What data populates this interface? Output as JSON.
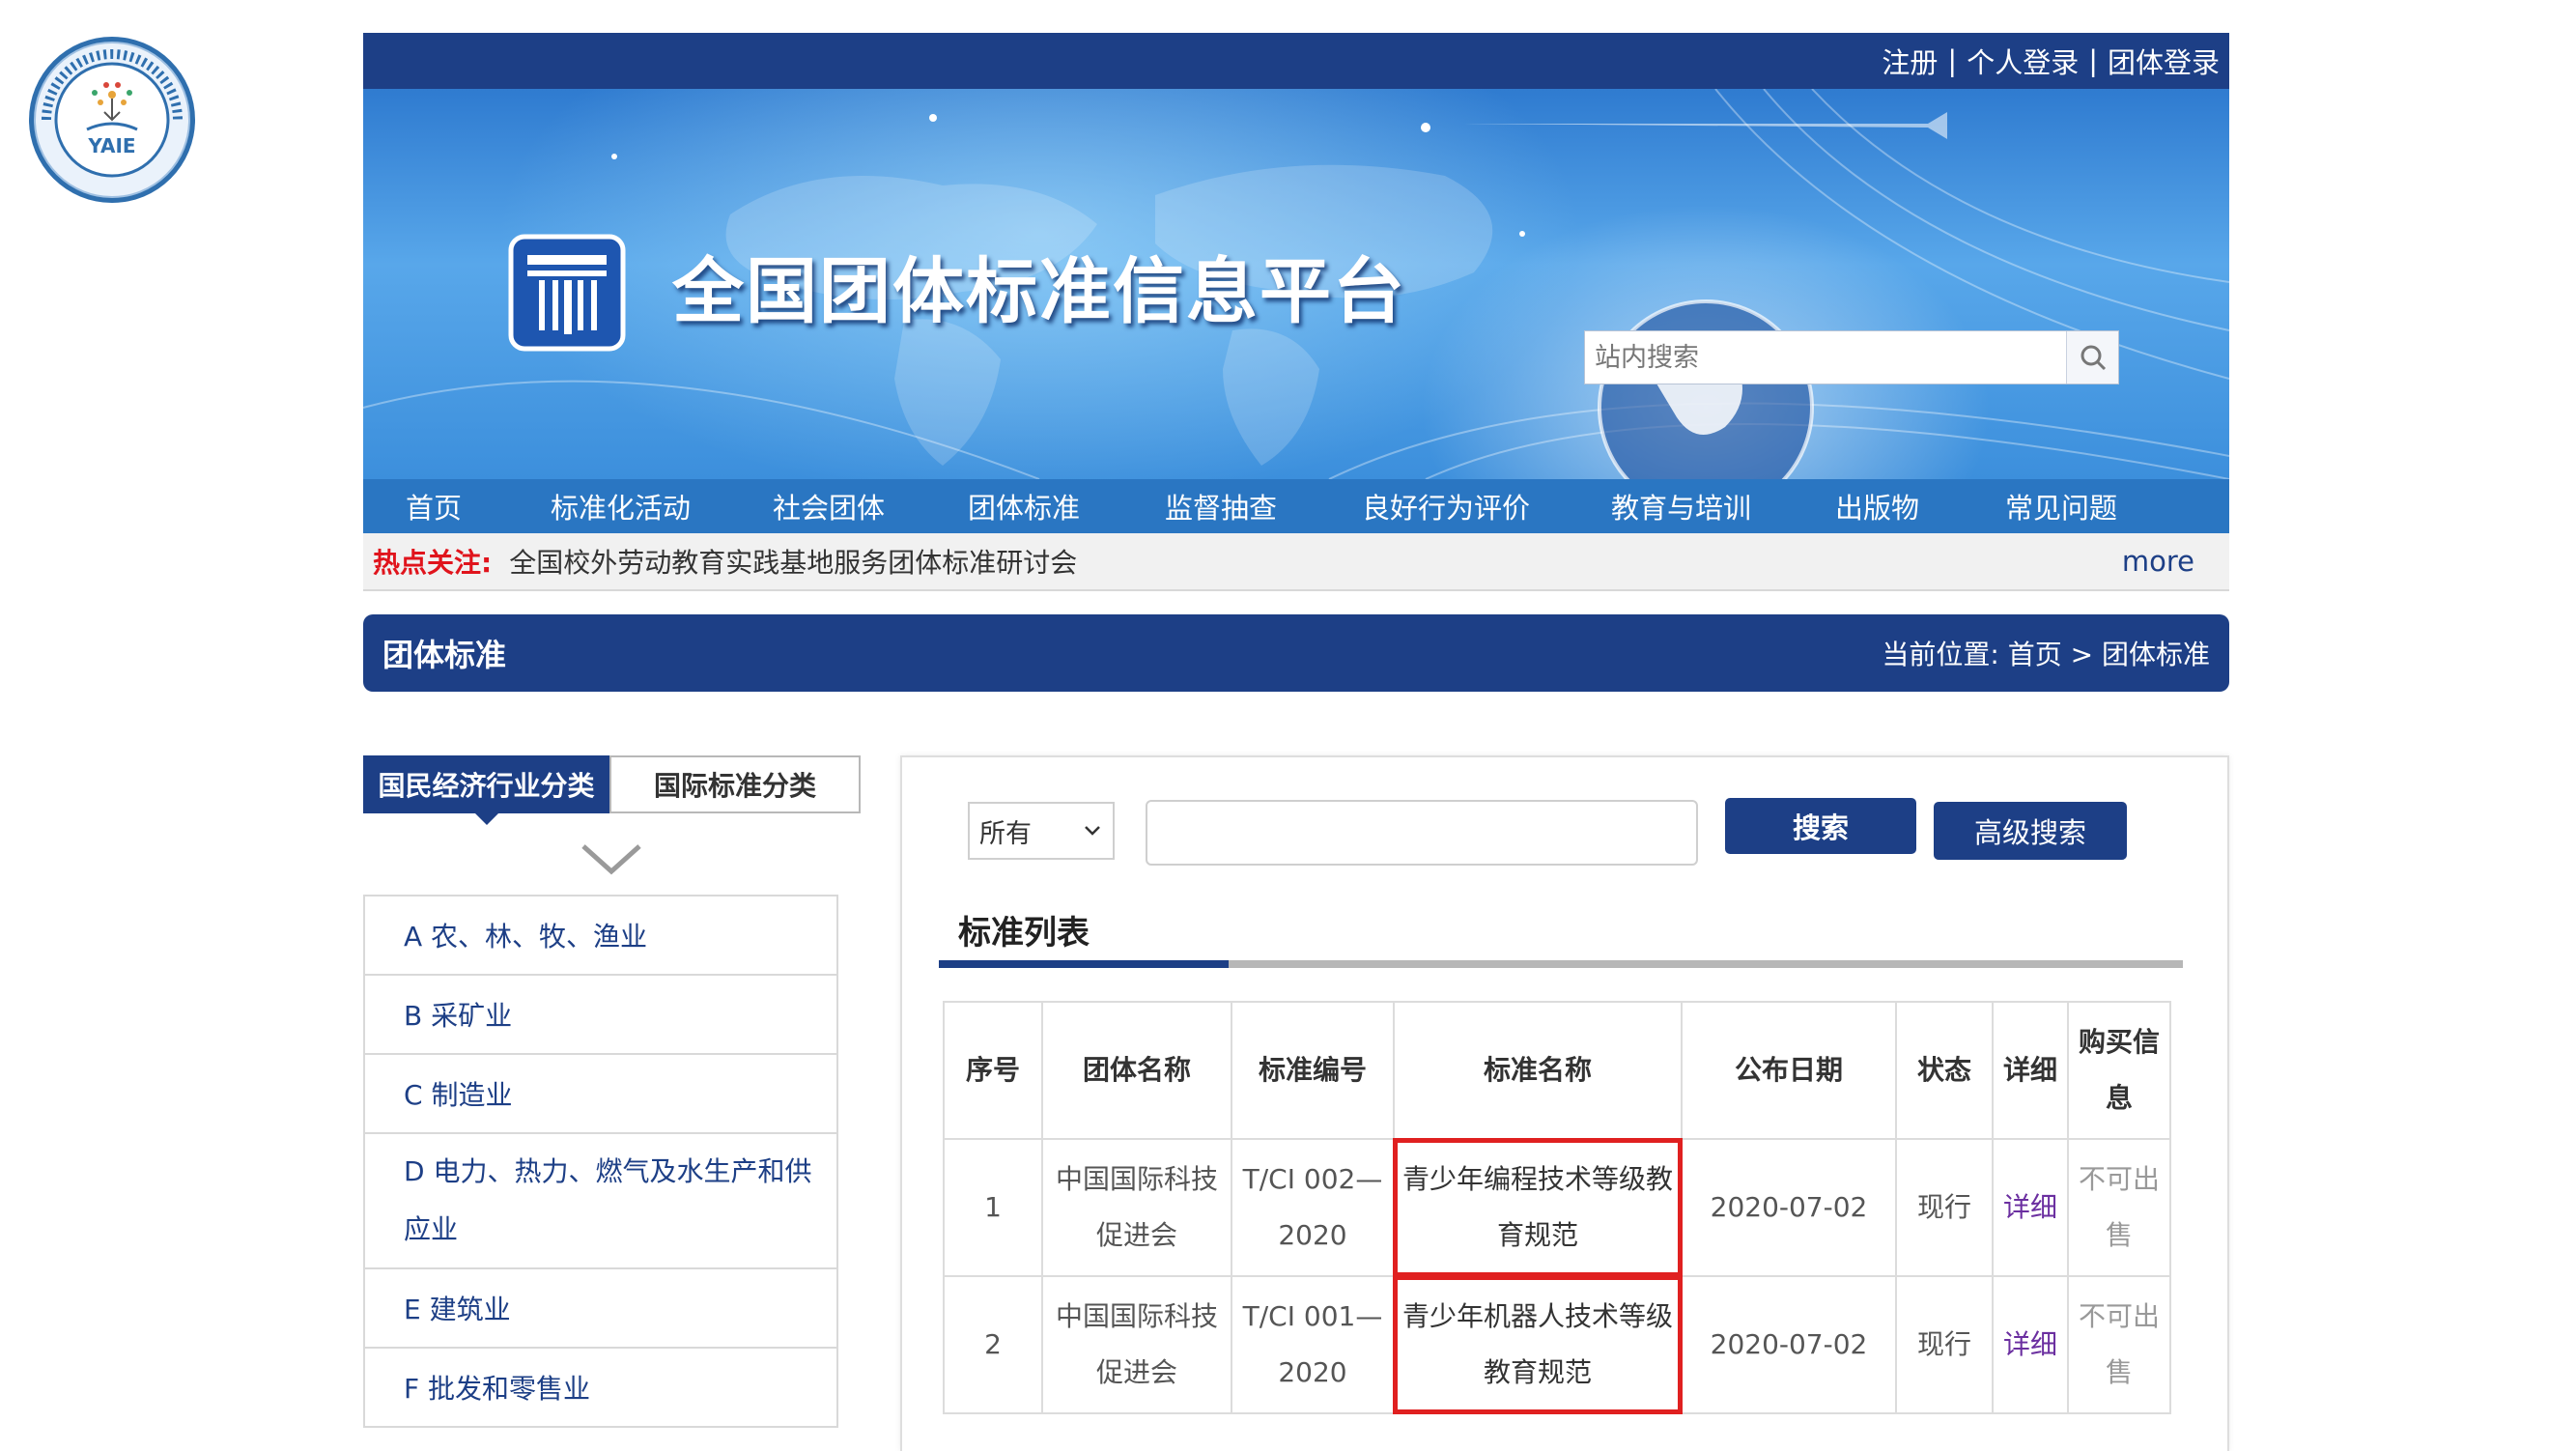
{
  "seal": {
    "text": "YAIE"
  },
  "topbar": {
    "register": "注册",
    "personal_login": "个人登录",
    "group_login": "团体登录",
    "separator": "|"
  },
  "banner": {
    "title": "全国团体标准信息平台",
    "search_placeholder": "站内搜索"
  },
  "nav": [
    "首页",
    "标准化活动",
    "社会团体",
    "团体标准",
    "监督抽查",
    "良好行为评价",
    "教育与培训",
    "出版物",
    "常见问题"
  ],
  "hot": {
    "label": "热点关注:",
    "text": "全国校外劳动教育实践基地服务团体标准研讨会",
    "more": "more"
  },
  "section": {
    "title": "团体标准",
    "breadcrumb_prefix": "当前位置:",
    "breadcrumb_home": "首页",
    "breadcrumb_sep": ">",
    "breadcrumb_current": "团体标准"
  },
  "sidebar": {
    "tabs": [
      "国民经济行业分类",
      "国际标准分类"
    ],
    "categories": [
      "A 农、林、牧、渔业",
      "B 采矿业",
      "C 制造业",
      "D 电力、热力、燃气及水生产和供应业",
      "E 建筑业",
      "F 批发和零售业"
    ]
  },
  "search": {
    "scope": "所有",
    "keyword": "",
    "search_button": "搜索",
    "advanced_button": "高级搜索"
  },
  "list": {
    "title": "标准列表",
    "headers": [
      "序号",
      "团体名称",
      "标准编号",
      "标准名称",
      "公布日期",
      "状态",
      "详细",
      "购买信息"
    ],
    "rows": [
      {
        "no": "1",
        "org": "中国国际科技促进会",
        "code": "T/CI 002—2020",
        "name": "青少年编程技术等级教育规范",
        "date": "2020-07-02",
        "status": "现行",
        "detail": "详细",
        "purchase": "不可出售"
      },
      {
        "no": "2",
        "org": "中国国际科技促进会",
        "code": "T/CI 001—2020",
        "name": "青少年机器人技术等级教育规范",
        "date": "2020-07-02",
        "status": "现行",
        "detail": "详细",
        "purchase": "不可出售"
      }
    ]
  },
  "colors": {
    "primary": "#1d3f86",
    "nav": "#2a76c2",
    "hot_label": "#e0141c",
    "highlight_box": "#e02020",
    "detail_link": "#6b2fa0"
  }
}
